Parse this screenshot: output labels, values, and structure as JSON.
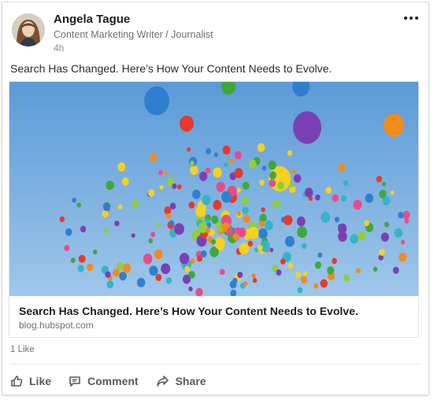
{
  "author": {
    "name": "Angela Tague",
    "title": "Content Marketing Writer / Journalist",
    "time": "4h"
  },
  "post": {
    "text": "Search Has Changed. Here’s How Your Content Needs to Evolve."
  },
  "link_preview": {
    "title": "Search Has Changed. Here’s How Your Content Needs to Evolve.",
    "domain": "blog.hubspot.com",
    "image_subject": "colorful balloons in blue sky"
  },
  "social": {
    "likes": "1 Like"
  },
  "actions": {
    "like": "Like",
    "comment": "Comment",
    "share": "Share"
  },
  "icons": [
    "more-icon",
    "like-icon",
    "comment-icon",
    "share-icon"
  ],
  "colors": {
    "sky_top": "#5b9ad8",
    "sky_bottom": "#9fc7ea",
    "text_secondary": "#707070",
    "action_text": "#5a5a5a"
  }
}
